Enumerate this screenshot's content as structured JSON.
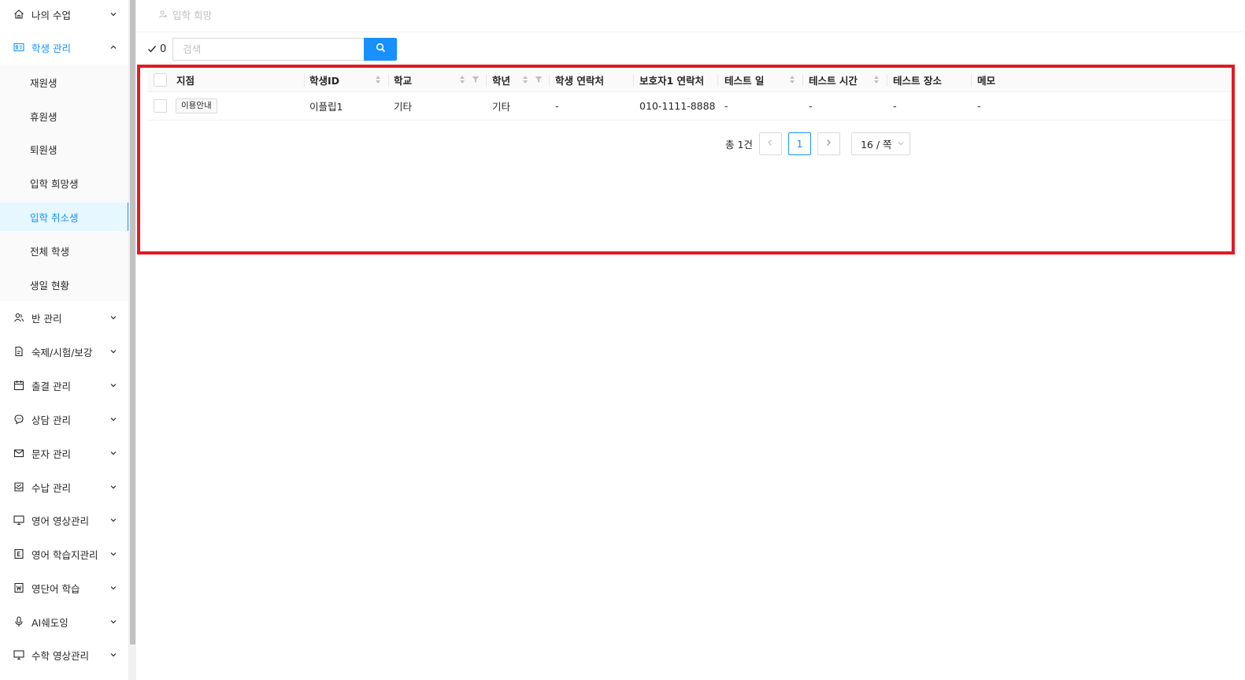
{
  "sidebar": {
    "items": [
      {
        "label": "나의 수업",
        "icon": "home-icon"
      },
      {
        "label": "학생 관리",
        "icon": "id-card-icon",
        "open": true
      },
      {
        "label": "반 관리",
        "icon": "users-icon"
      },
      {
        "label": "숙제/시험/보강",
        "icon": "file-edit-icon"
      },
      {
        "label": "출결 관리",
        "icon": "calendar-icon"
      },
      {
        "label": "상담 관리",
        "icon": "chat-icon"
      },
      {
        "label": "문자 관리",
        "icon": "mail-icon"
      },
      {
        "label": "수납 관리",
        "icon": "inbox-check-icon"
      },
      {
        "label": "영어 영상관리",
        "icon": "monitor-icon"
      },
      {
        "label": "영어 학습지관리",
        "icon": "book-e-icon"
      },
      {
        "label": "영단어 학습",
        "icon": "book-w-icon"
      },
      {
        "label": "AI쉐도잉",
        "icon": "microphone-icon"
      },
      {
        "label": "수학 영상관리",
        "icon": "monitor-icon"
      }
    ],
    "submenu": [
      {
        "label": "재원생"
      },
      {
        "label": "휴원생"
      },
      {
        "label": "퇴원생"
      },
      {
        "label": "입학 희망생"
      },
      {
        "label": "입학 취소생",
        "active": true
      },
      {
        "label": "전체 학생"
      },
      {
        "label": "생일 현황"
      }
    ]
  },
  "breadcrumb": {
    "label": "입학 희망"
  },
  "toolbar": {
    "selected_count": "0",
    "search_placeholder": "검색",
    "search_value": ""
  },
  "table": {
    "columns": [
      "지점",
      "학생ID",
      "학교",
      "학년",
      "학생 연락처",
      "보호자1 연락처",
      "테스트 일",
      "테스트 시간",
      "테스트 장소",
      "메모"
    ],
    "rows": [
      {
        "branch": "이용안내",
        "student_id": "이플립1",
        "school": "기타",
        "grade": "기타",
        "student_phone": "-",
        "guardian_phone": "010-1111-8888",
        "test_date": "-",
        "test_time": "-",
        "test_place": "-",
        "memo": "-"
      }
    ]
  },
  "pagination": {
    "total": "총 1건",
    "current_page": "1",
    "page_size": "16 / 쪽"
  },
  "colors": {
    "accent": "#1890ff",
    "highlight_border": "#e01b24"
  }
}
